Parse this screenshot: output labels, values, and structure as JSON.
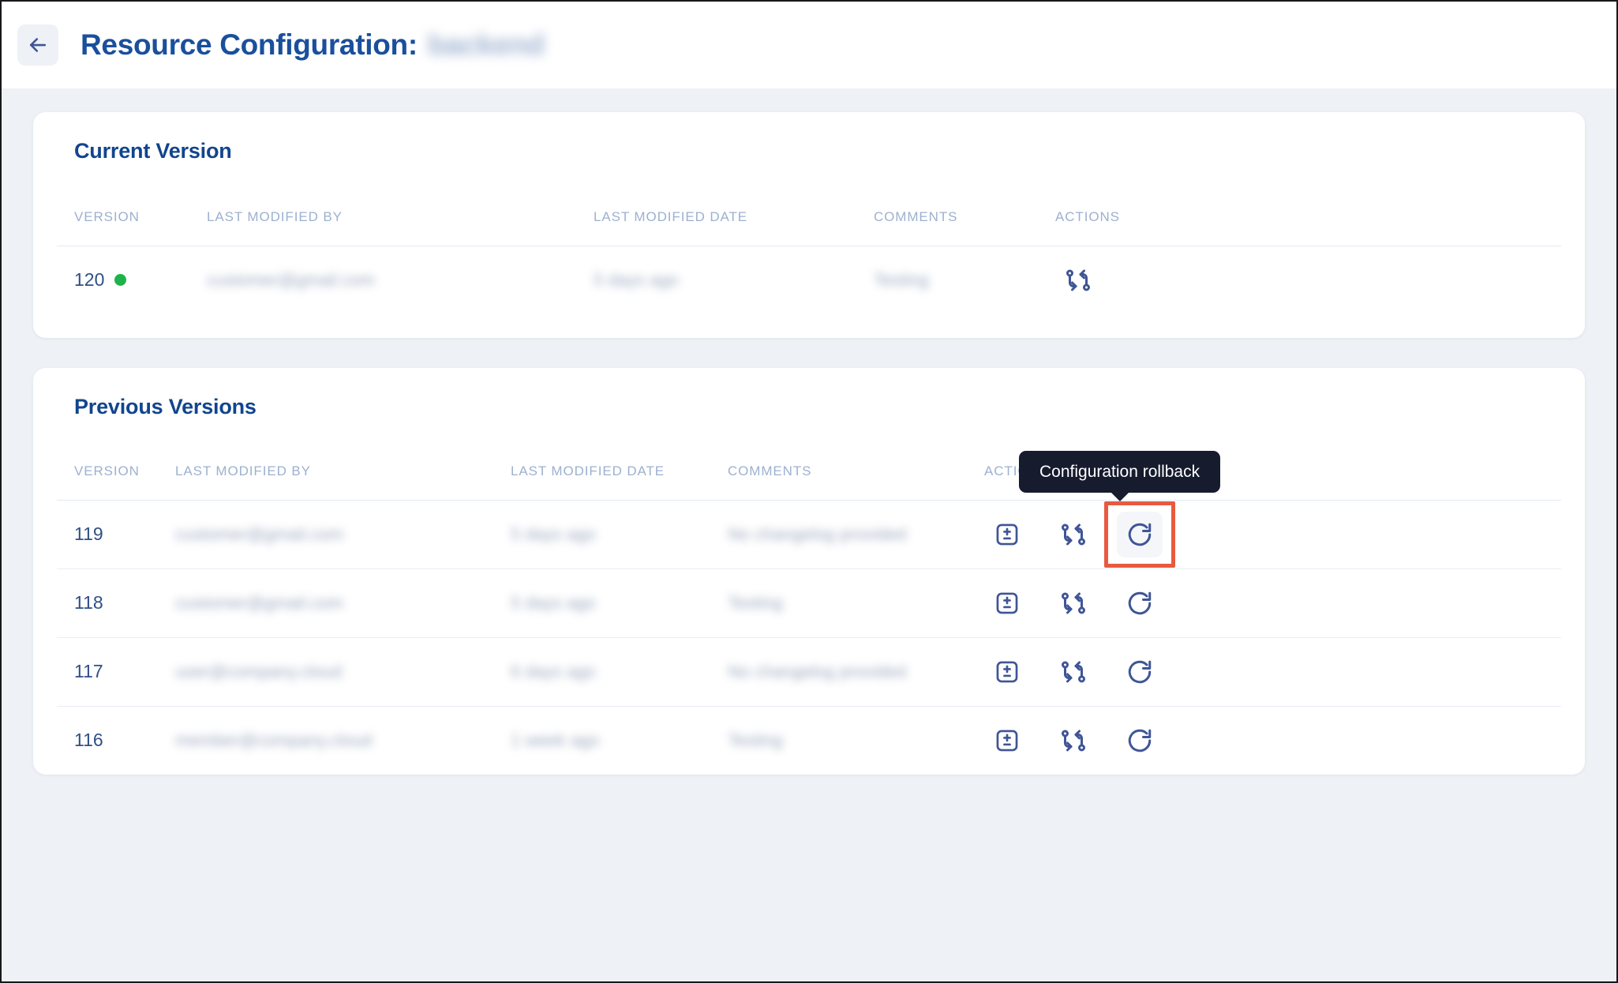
{
  "header": {
    "back_icon": "arrow-left-icon",
    "title_prefix": "Resource Configuration:",
    "resource_name": "backend"
  },
  "current_version_section": {
    "title": "Current Version",
    "columns": [
      "VERSION",
      "LAST MODIFIED BY",
      "LAST MODIFIED DATE",
      "COMMENTS",
      "ACTIONS"
    ],
    "rows": [
      {
        "version": "120",
        "status": "active",
        "status_color": "#1eb34a",
        "last_modified_by": "customer@gmail.com",
        "last_modified_date": "5 days ago",
        "comments": "Testing",
        "actions": [
          "compare-icon"
        ]
      }
    ]
  },
  "previous_versions_section": {
    "title": "Previous Versions",
    "columns": [
      "VERSION",
      "LAST MODIFIED BY",
      "LAST MODIFIED DATE",
      "COMMENTS",
      "ACTIONS"
    ],
    "rows": [
      {
        "version": "119",
        "last_modified_by": "customer@gmail.com",
        "last_modified_date": "5 days ago",
        "comments": "No changelog provided",
        "actions": [
          "diff-icon",
          "compare-icon",
          "rollback-icon"
        ]
      },
      {
        "version": "118",
        "last_modified_by": "customer@gmail.com",
        "last_modified_date": "5 days ago",
        "comments": "Testing",
        "actions": [
          "diff-icon",
          "compare-icon",
          "rollback-icon"
        ]
      },
      {
        "version": "117",
        "last_modified_by": "user@company.cloud",
        "last_modified_date": "6 days ago",
        "comments": "No changelog provided",
        "actions": [
          "diff-icon",
          "compare-icon",
          "rollback-icon"
        ]
      },
      {
        "version": "116",
        "last_modified_by": "member@company.cloud",
        "last_modified_date": "1 week ago",
        "comments": "Testing",
        "actions": [
          "diff-icon",
          "compare-icon",
          "rollback-icon"
        ]
      }
    ]
  },
  "tooltip": {
    "text": "Configuration rollback",
    "background": "#161b2e"
  },
  "highlight": {
    "color": "#e9593f",
    "target": "rollback-button-row-119"
  },
  "theme": {
    "page_background": "#eef1f6",
    "card_background": "#ffffff",
    "title_blue": "#11458e",
    "icon_blue": "#3f5596",
    "header_text": "#9cb1cf"
  }
}
